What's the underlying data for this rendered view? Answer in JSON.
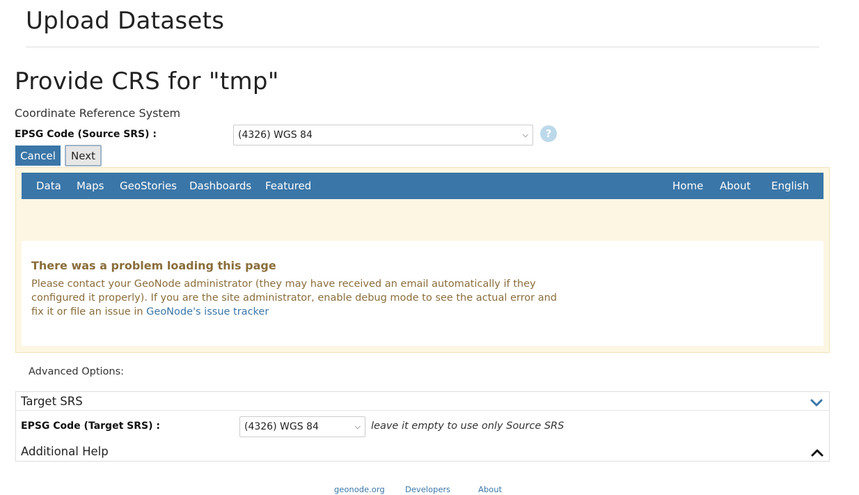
{
  "page": {
    "title": "Upload Datasets"
  },
  "crs": {
    "heading": "Provide CRS for \"tmp\"",
    "subheading": "Coordinate Reference System",
    "source_label": "EPSG Code (Source SRS) :",
    "source_value": "(4326) WGS 84",
    "help_icon_glyph": "?"
  },
  "buttons": {
    "cancel": "Cancel",
    "next": "Next"
  },
  "navbar": {
    "left": [
      "Data",
      "Maps",
      "GeoStories",
      "Dashboards",
      "Featured"
    ],
    "right": [
      "Home",
      "About",
      "English"
    ]
  },
  "error": {
    "title": "There was a problem loading this page",
    "text": "Please contact your GeoNode administrator (they may have received an email automatically if they configured it properly). If you are the site administrator, enable debug mode to see the actual error and fix it or file an issue in ",
    "link": "GeoNode's issue tracker"
  },
  "advanced": {
    "label": "Advanced Options:",
    "target_title": "Target SRS",
    "target_label": "EPSG Code (Target SRS) :",
    "target_value": "(4326) WGS 84",
    "target_hint": "leave it empty to use only Source SRS",
    "additional_help_title": "Additional Help"
  },
  "footer": {
    "links": [
      "geonode.org",
      "Developers",
      "About"
    ]
  },
  "colors": {
    "accent": "#3a76a8",
    "warning_bg": "#fdf6e3",
    "warning_text": "#8a6d3b",
    "help_icon": "#bcd9ea"
  }
}
